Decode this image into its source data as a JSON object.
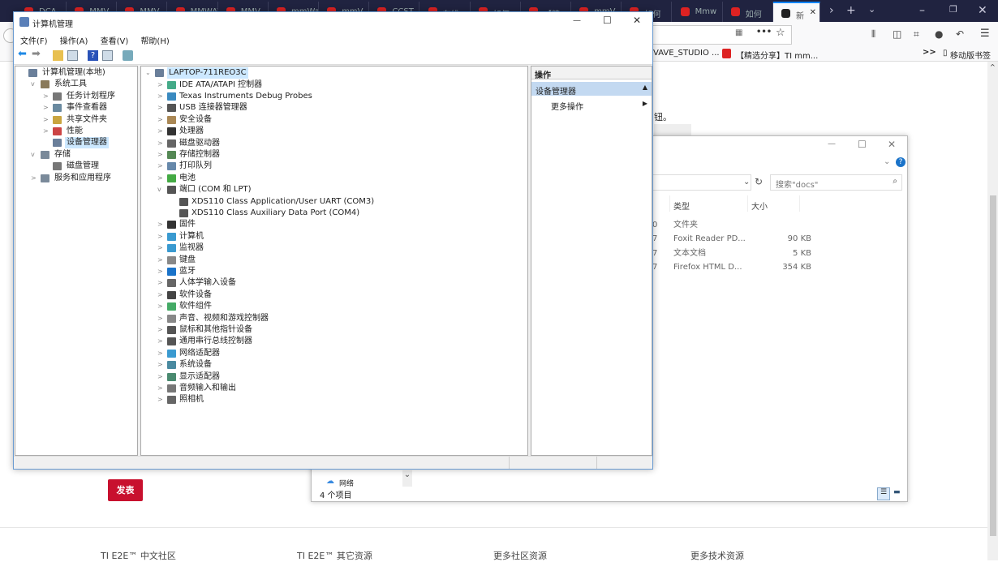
{
  "browser": {
    "tabs": [
      "DCA",
      "MMV",
      "MMV",
      "MMWAV",
      "MMV",
      "mmWav",
      "mmV",
      "CCST",
      "在线",
      "如何",
      "【精",
      "mmV",
      "如何",
      "Mmw",
      "如何",
      "新"
    ],
    "active_tab_index": 15,
    "bookmarks": [
      "VAVE_STUDIO ...",
      "【精选分享】TI mm..."
    ],
    "mobile_bookmarks": "移动版书签",
    "overflow": ">>"
  },
  "page": {
    "partial_text": "钮。",
    "post_button": "发表",
    "footer": [
      "TI E2E™ 中文社区",
      "TI E2E™ 其它资源",
      "更多社区资源",
      "更多技术资源"
    ]
  },
  "explorer": {
    "search_placeholder": "搜索\"docs\"",
    "columns": [
      "类型",
      "大小"
    ],
    "rows": [
      {
        "date_tail": "0",
        "type": "文件夹",
        "size": ""
      },
      {
        "date_tail": "7",
        "type": "Foxit Reader PD...",
        "size": "90 KB"
      },
      {
        "date_tail": "7",
        "type": "文本文档",
        "size": "5 KB"
      },
      {
        "date_tail": "7",
        "type": "Firefox HTML D...",
        "size": "354 KB"
      }
    ],
    "nav_item": "网络",
    "status": "4 个项目"
  },
  "cm": {
    "title": "计算机管理",
    "menu": [
      "文件(F)",
      "操作(A)",
      "查看(V)",
      "帮助(H)"
    ],
    "tree": [
      {
        "label": "计算机管理(本地)",
        "level": 0,
        "exp": ""
      },
      {
        "label": "系统工具",
        "level": 1,
        "exp": "v"
      },
      {
        "label": "任务计划程序",
        "level": 2,
        "exp": ">"
      },
      {
        "label": "事件查看器",
        "level": 2,
        "exp": ">"
      },
      {
        "label": "共享文件夹",
        "level": 2,
        "exp": ">"
      },
      {
        "label": "性能",
        "level": 2,
        "exp": ">"
      },
      {
        "label": "设备管理器",
        "level": 2,
        "exp": "",
        "selected": true
      },
      {
        "label": "存储",
        "level": 1,
        "exp": "v"
      },
      {
        "label": "磁盘管理",
        "level": 2,
        "exp": ""
      },
      {
        "label": "服务和应用程序",
        "level": 1,
        "exp": ">"
      }
    ],
    "computer": "LAPTOP-711REO3C",
    "devices": [
      {
        "label": "IDE ATA/ATAPI 控制器",
        "level": 1,
        "exp": ">"
      },
      {
        "label": "Texas Instruments Debug Probes",
        "level": 1,
        "exp": ">"
      },
      {
        "label": "USB 连接器管理器",
        "level": 1,
        "exp": ">"
      },
      {
        "label": "安全设备",
        "level": 1,
        "exp": ">"
      },
      {
        "label": "处理器",
        "level": 1,
        "exp": ">"
      },
      {
        "label": "磁盘驱动器",
        "level": 1,
        "exp": ">"
      },
      {
        "label": "存储控制器",
        "level": 1,
        "exp": ">"
      },
      {
        "label": "打印队列",
        "level": 1,
        "exp": ">"
      },
      {
        "label": "电池",
        "level": 1,
        "exp": ">"
      },
      {
        "label": "端口 (COM 和 LPT)",
        "level": 1,
        "exp": "v"
      },
      {
        "label": "XDS110 Class Application/User UART (COM3)",
        "level": 2,
        "exp": ""
      },
      {
        "label": "XDS110 Class Auxiliary Data Port (COM4)",
        "level": 2,
        "exp": ""
      },
      {
        "label": "固件",
        "level": 1,
        "exp": ">"
      },
      {
        "label": "计算机",
        "level": 1,
        "exp": ">"
      },
      {
        "label": "监视器",
        "level": 1,
        "exp": ">"
      },
      {
        "label": "键盘",
        "level": 1,
        "exp": ">"
      },
      {
        "label": "蓝牙",
        "level": 1,
        "exp": ">"
      },
      {
        "label": "人体学输入设备",
        "level": 1,
        "exp": ">"
      },
      {
        "label": "软件设备",
        "level": 1,
        "exp": ">"
      },
      {
        "label": "软件组件",
        "level": 1,
        "exp": ">"
      },
      {
        "label": "声音、视频和游戏控制器",
        "level": 1,
        "exp": ">"
      },
      {
        "label": "鼠标和其他指针设备",
        "level": 1,
        "exp": ">"
      },
      {
        "label": "通用串行总线控制器",
        "level": 1,
        "exp": ">"
      },
      {
        "label": "网络适配器",
        "level": 1,
        "exp": ">"
      },
      {
        "label": "系统设备",
        "level": 1,
        "exp": ">"
      },
      {
        "label": "显示适配器",
        "level": 1,
        "exp": ">"
      },
      {
        "label": "音频输入和输出",
        "level": 1,
        "exp": ">"
      },
      {
        "label": "照相机",
        "level": 1,
        "exp": ">"
      }
    ],
    "actions": {
      "header": "操作",
      "section": "设备管理器",
      "more": "更多操作"
    }
  }
}
